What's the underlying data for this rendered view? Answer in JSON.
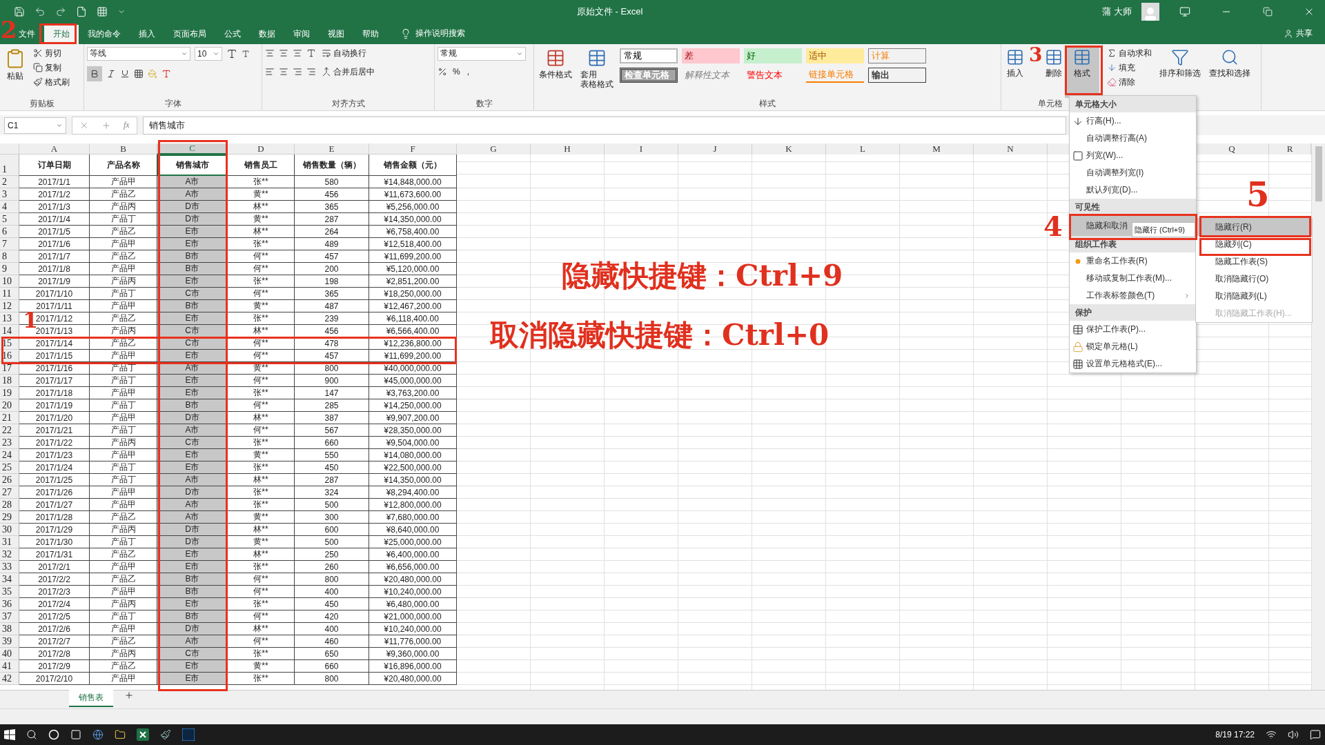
{
  "title_bar": {
    "title": "原始文件  -  Excel",
    "user": "蒲 大师"
  },
  "tabs": [
    {
      "label": "文件",
      "selected": false
    },
    {
      "label": "开始",
      "selected": true
    },
    {
      "label": "我的命令",
      "selected": false
    },
    {
      "label": "插入",
      "selected": false
    },
    {
      "label": "页面布局",
      "selected": false
    },
    {
      "label": "公式",
      "selected": false
    },
    {
      "label": "数据",
      "selected": false
    },
    {
      "label": "审阅",
      "selected": false
    },
    {
      "label": "视图",
      "selected": false
    },
    {
      "label": "帮助",
      "selected": false
    }
  ],
  "tell_me": "操作说明搜索",
  "share": "共享",
  "ribbon": {
    "clipboard": {
      "label": "剪贴板",
      "paste": "粘贴",
      "items": [
        "剪切",
        "复制",
        "格式刷"
      ]
    },
    "font": {
      "label": "字体",
      "name": "等线",
      "size": "10"
    },
    "alignment": {
      "label": "对齐方式",
      "wrap": "自动换行",
      "merge": "合并后居中"
    },
    "number": {
      "label": "数字",
      "format": "常规",
      "percent": "%",
      "comma": ","
    },
    "styles": {
      "label": "样式",
      "conditional": "条件格式",
      "table": [
        "套用",
        "表格格式"
      ],
      "gallery": [
        {
          "kind": "normal",
          "label": "常规"
        },
        {
          "kind": "bad",
          "label": "差"
        },
        {
          "kind": "good",
          "label": "好"
        },
        {
          "kind": "neutral",
          "label": "适中"
        },
        {
          "kind": "calc",
          "label": "计算"
        },
        {
          "kind": "check",
          "label": "检查单元格"
        },
        {
          "kind": "explanatory",
          "label": "解释性文本"
        },
        {
          "kind": "warning",
          "label": "警告文本"
        },
        {
          "kind": "linked",
          "label": "链接单元格"
        },
        {
          "kind": "output",
          "label": "输出"
        }
      ]
    },
    "cells": {
      "label": "单元格",
      "insert": "插入",
      "delete": "删除",
      "format": "格式"
    },
    "editing": {
      "autosum": "自动求和",
      "fill": "填充",
      "clear": "清除",
      "sort": "排序和筛选",
      "find": "查找和选择"
    }
  },
  "formula_bar": {
    "name_box": "C1",
    "fx": "fx",
    "content": "销售城市"
  },
  "columns": [
    {
      "label": "A",
      "selected": false
    },
    {
      "label": "B",
      "selected": false
    },
    {
      "label": "C",
      "selected": true
    },
    {
      "label": "D",
      "selected": false
    },
    {
      "label": "E",
      "selected": false
    },
    {
      "label": "F",
      "selected": false
    },
    {
      "label": "G",
      "selected": false
    },
    {
      "label": "H",
      "selected": false
    },
    {
      "label": "I",
      "selected": false
    },
    {
      "label": "J",
      "selected": false
    },
    {
      "label": "K",
      "selected": false
    },
    {
      "label": "L",
      "selected": false
    },
    {
      "label": "M",
      "selected": false
    },
    {
      "label": "N",
      "selected": false
    }
  ],
  "columns_right": [
    {
      "label": "Q",
      "selected": false
    },
    {
      "label": "R",
      "selected": false
    }
  ],
  "header_row": {
    "num": "1",
    "cells": [
      "订单日期",
      "产品名称",
      "销售城市",
      "销售员工",
      "销售数量（辆）",
      "销售金额（元）"
    ]
  },
  "rows": [
    {
      "num": "2",
      "cells": [
        "2017/1/1",
        "产品甲",
        "A市",
        "张**",
        "580",
        "¥14,848,000.00"
      ]
    },
    {
      "num": "3",
      "cells": [
        "2017/1/2",
        "产品乙",
        "A市",
        "黄**",
        "456",
        "¥11,673,600.00"
      ]
    },
    {
      "num": "4",
      "cells": [
        "2017/1/3",
        "产品丙",
        "D市",
        "林**",
        "365",
        "¥5,256,000.00"
      ]
    },
    {
      "num": "5",
      "cells": [
        "2017/1/4",
        "产品丁",
        "D市",
        "黄**",
        "287",
        "¥14,350,000.00"
      ]
    },
    {
      "num": "6",
      "cells": [
        "2017/1/5",
        "产品乙",
        "E市",
        "林**",
        "264",
        "¥6,758,400.00"
      ]
    },
    {
      "num": "7",
      "cells": [
        "2017/1/6",
        "产品甲",
        "E市",
        "张**",
        "489",
        "¥12,518,400.00"
      ]
    },
    {
      "num": "8",
      "cells": [
        "2017/1/7",
        "产品乙",
        "B市",
        "何**",
        "457",
        "¥11,699,200.00"
      ]
    },
    {
      "num": "9",
      "cells": [
        "2017/1/8",
        "产品甲",
        "B市",
        "何**",
        "200",
        "¥5,120,000.00"
      ]
    },
    {
      "num": "10",
      "cells": [
        "2017/1/9",
        "产品丙",
        "E市",
        "张**",
        "198",
        "¥2,851,200.00"
      ]
    },
    {
      "num": "11",
      "cells": [
        "2017/1/10",
        "产品丁",
        "C市",
        "何**",
        "365",
        "¥18,250,000.00"
      ]
    },
    {
      "num": "12",
      "cells": [
        "2017/1/11",
        "产品甲",
        "B市",
        "黄**",
        "487",
        "¥12,467,200.00"
      ]
    },
    {
      "num": "13",
      "cells": [
        "2017/1/12",
        "产品乙",
        "E市",
        "张**",
        "239",
        "¥6,118,400.00"
      ]
    },
    {
      "num": "14",
      "cells": [
        "2017/1/13",
        "产品丙",
        "C市",
        "林**",
        "456",
        "¥6,566,400.00"
      ]
    },
    {
      "num": "15",
      "cells": [
        "2017/1/14",
        "产品乙",
        "C市",
        "何**",
        "478",
        "¥12,236,800.00"
      ]
    },
    {
      "num": "16",
      "cells": [
        "2017/1/15",
        "产品甲",
        "E市",
        "何**",
        "457",
        "¥11,699,200.00"
      ]
    },
    {
      "num": "17",
      "cells": [
        "2017/1/16",
        "产品丁",
        "A市",
        "黄**",
        "800",
        "¥40,000,000.00"
      ]
    },
    {
      "num": "18",
      "cells": [
        "2017/1/17",
        "产品丁",
        "E市",
        "何**",
        "900",
        "¥45,000,000.00"
      ]
    },
    {
      "num": "19",
      "cells": [
        "2017/1/18",
        "产品甲",
        "E市",
        "张**",
        "147",
        "¥3,763,200.00"
      ]
    },
    {
      "num": "20",
      "cells": [
        "2017/1/19",
        "产品丁",
        "B市",
        "何**",
        "285",
        "¥14,250,000.00"
      ]
    },
    {
      "num": "21",
      "cells": [
        "2017/1/20",
        "产品甲",
        "D市",
        "林**",
        "387",
        "¥9,907,200.00"
      ]
    },
    {
      "num": "22",
      "cells": [
        "2017/1/21",
        "产品丁",
        "A市",
        "何**",
        "567",
        "¥28,350,000.00"
      ]
    },
    {
      "num": "23",
      "cells": [
        "2017/1/22",
        "产品丙",
        "C市",
        "张**",
        "660",
        "¥9,504,000.00"
      ]
    },
    {
      "num": "24",
      "cells": [
        "2017/1/23",
        "产品甲",
        "E市",
        "黄**",
        "550",
        "¥14,080,000.00"
      ]
    },
    {
      "num": "25",
      "cells": [
        "2017/1/24",
        "产品丁",
        "E市",
        "张**",
        "450",
        "¥22,500,000.00"
      ]
    },
    {
      "num": "26",
      "cells": [
        "2017/1/25",
        "产品丁",
        "A市",
        "林**",
        "287",
        "¥14,350,000.00"
      ]
    },
    {
      "num": "27",
      "cells": [
        "2017/1/26",
        "产品甲",
        "D市",
        "张**",
        "324",
        "¥8,294,400.00"
      ]
    },
    {
      "num": "28",
      "cells": [
        "2017/1/27",
        "产品甲",
        "A市",
        "张**",
        "500",
        "¥12,800,000.00"
      ]
    },
    {
      "num": "29",
      "cells": [
        "2017/1/28",
        "产品乙",
        "A市",
        "黄**",
        "300",
        "¥7,680,000.00"
      ]
    },
    {
      "num": "30",
      "cells": [
        "2017/1/29",
        "产品丙",
        "D市",
        "林**",
        "600",
        "¥8,640,000.00"
      ]
    },
    {
      "num": "31",
      "cells": [
        "2017/1/30",
        "产品丁",
        "D市",
        "黄**",
        "500",
        "¥25,000,000.00"
      ]
    },
    {
      "num": "32",
      "cells": [
        "2017/1/31",
        "产品乙",
        "E市",
        "林**",
        "250",
        "¥6,400,000.00"
      ]
    },
    {
      "num": "33",
      "cells": [
        "2017/2/1",
        "产品甲",
        "E市",
        "张**",
        "260",
        "¥6,656,000.00"
      ]
    },
    {
      "num": "34",
      "cells": [
        "2017/2/2",
        "产品乙",
        "B市",
        "何**",
        "800",
        "¥20,480,000.00"
      ]
    },
    {
      "num": "35",
      "cells": [
        "2017/2/3",
        "产品甲",
        "B市",
        "何**",
        "400",
        "¥10,240,000.00"
      ]
    },
    {
      "num": "36",
      "cells": [
        "2017/2/4",
        "产品丙",
        "E市",
        "张**",
        "450",
        "¥6,480,000.00"
      ]
    },
    {
      "num": "37",
      "cells": [
        "2017/2/5",
        "产品丁",
        "B市",
        "何**",
        "420",
        "¥21,000,000.00"
      ]
    },
    {
      "num": "38",
      "cells": [
        "2017/2/6",
        "产品甲",
        "D市",
        "林**",
        "400",
        "¥10,240,000.00"
      ]
    },
    {
      "num": "39",
      "cells": [
        "2017/2/7",
        "产品乙",
        "A市",
        "何**",
        "460",
        "¥11,776,000.00"
      ]
    },
    {
      "num": "40",
      "cells": [
        "2017/2/8",
        "产品丙",
        "C市",
        "张**",
        "650",
        "¥9,360,000.00"
      ]
    },
    {
      "num": "41",
      "cells": [
        "2017/2/9",
        "产品乙",
        "E市",
        "黄**",
        "660",
        "¥16,896,000.00"
      ]
    },
    {
      "num": "42",
      "cells": [
        "2017/2/10",
        "产品甲",
        "E市",
        "张**",
        "800",
        "¥20,480,000.00"
      ]
    }
  ],
  "format_menu": [
    {
      "heading": "单元格大小",
      "items": [
        {
          "kind": "rowheight",
          "label": "行高(H)...",
          "selected": false
        },
        {
          "kind": "plain",
          "label": "自动调整行高(A)",
          "selected": false
        },
        {
          "kind": "colwidth",
          "label": "列宽(W)...",
          "selected": false
        },
        {
          "kind": "plain",
          "label": "自动调整列宽(I)",
          "selected": false
        },
        {
          "kind": "plain",
          "label": "默认列宽(D)...",
          "selected": false
        }
      ]
    },
    {
      "heading": "可见性",
      "items": [
        {
          "kind": "submenu",
          "label": "隐藏和取消",
          "selected": true
        }
      ]
    },
    {
      "heading": "组织工作表",
      "items": [
        {
          "kind": "bullet",
          "label": "重命名工作表(R)",
          "selected": false
        },
        {
          "kind": "plain",
          "label": "移动或复制工作表(M)...",
          "selected": false
        },
        {
          "kind": "arrow",
          "label": "工作表标签颜色(T)",
          "selected": false
        }
      ]
    },
    {
      "heading": "保护",
      "items": [
        {
          "kind": "protect",
          "label": "保护工作表(P)...",
          "selected": false
        },
        {
          "kind": "lock",
          "label": "锁定单元格(L)",
          "selected": false
        },
        {
          "kind": "format",
          "label": "设置单元格格式(E)...",
          "selected": false
        }
      ]
    }
  ],
  "tooltip": "隐藏行 (Ctrl+9)",
  "submenu": [
    {
      "label": "隐藏行(R)",
      "selected": true,
      "disabled": false
    },
    {
      "label": "隐藏列(C)",
      "selected": false,
      "disabled": false
    },
    {
      "label": "隐藏工作表(S)",
      "selected": false,
      "disabled": false
    },
    {
      "label": "取消隐藏行(O)",
      "selected": false,
      "disabled": false
    },
    {
      "label": "取消隐藏列(L)",
      "selected": false,
      "disabled": false
    },
    {
      "label": "取消隐藏工作表(H)...",
      "selected": false,
      "disabled": true
    }
  ],
  "annotations": {
    "markers": [
      "1",
      "2",
      "3",
      "4",
      "5"
    ],
    "captions": [
      "隐藏快捷键：Ctrl+9",
      "取消隐藏快捷键：Ctrl+0"
    ]
  },
  "sheet_tabs": [
    {
      "label": "销售表",
      "selected": true
    }
  ],
  "taskbar": {
    "clock": "8/19 17:22"
  }
}
